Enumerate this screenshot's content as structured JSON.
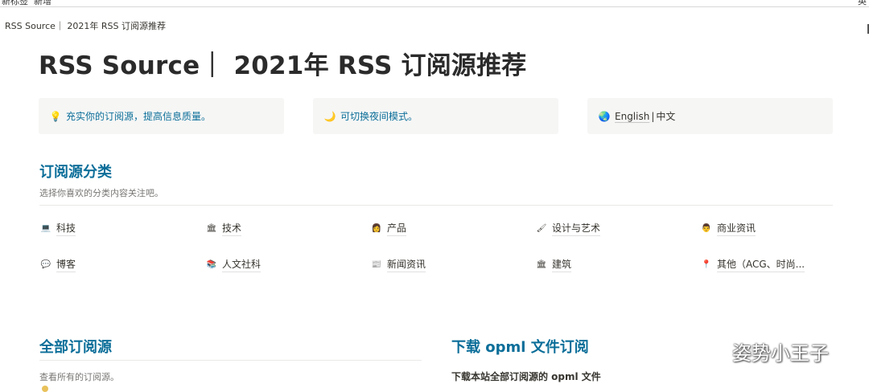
{
  "window": {
    "top_left_fragment_1": "新标签",
    "top_left_fragment_2": "新增",
    "top_right_fragment": "英"
  },
  "breadcrumb": {
    "text": "RSS Source｜ 2021年 RSS 订阅源推荐"
  },
  "page": {
    "title": "RSS Source｜ 2021年 RSS 订阅源推荐"
  },
  "callouts": [
    {
      "icon": "lightbulb-icon",
      "icon_glyph": "💡",
      "text": "充实你的订阅源，提高信息质量。"
    },
    {
      "icon": "moon-icon",
      "icon_glyph": "🌙",
      "text": "可切换夜间模式。"
    },
    {
      "icon": "globe-icon",
      "icon_glyph": "🌏",
      "lang_link": "English",
      "separator": "|",
      "lang_current": "中文"
    }
  ],
  "categories_section": {
    "heading": "订阅源分类",
    "description": "选择你喜欢的分类内容关注吧。",
    "items": [
      {
        "label": "科技",
        "icon": "laptop-icon",
        "glyph": "💻"
      },
      {
        "label": "技术",
        "icon": "bank-icon",
        "glyph": "🏛"
      },
      {
        "label": "产品",
        "icon": "person-icon",
        "glyph": "👩"
      },
      {
        "label": "设计与艺术",
        "icon": "brush-icon",
        "glyph": "🖌"
      },
      {
        "label": "商业资讯",
        "icon": "businessman-icon",
        "glyph": "👨"
      },
      {
        "label": "博客",
        "icon": "speech-bubble-icon",
        "glyph": "💬"
      },
      {
        "label": "人文社科",
        "icon": "books-icon",
        "glyph": "📚"
      },
      {
        "label": "新闻资讯",
        "icon": "newspaper-icon",
        "glyph": "📰"
      },
      {
        "label": "建筑",
        "icon": "building-icon",
        "glyph": "🏛"
      },
      {
        "label": "其他（ACG、时尚...",
        "icon": "pin-icon",
        "glyph": "📍"
      }
    ]
  },
  "all_feeds": {
    "heading": "全部订阅源",
    "description": "查看所有的订阅源。"
  },
  "opml": {
    "heading": "下载 opml 文件订阅",
    "subheading": "下载本站全部订阅源的 opml 文件"
  },
  "watermark": {
    "text": "姿势小王子"
  },
  "colors": {
    "accent": "#0b6e99",
    "text": "#37352f",
    "muted": "#787774",
    "callout_bg": "#f6f6f5"
  }
}
